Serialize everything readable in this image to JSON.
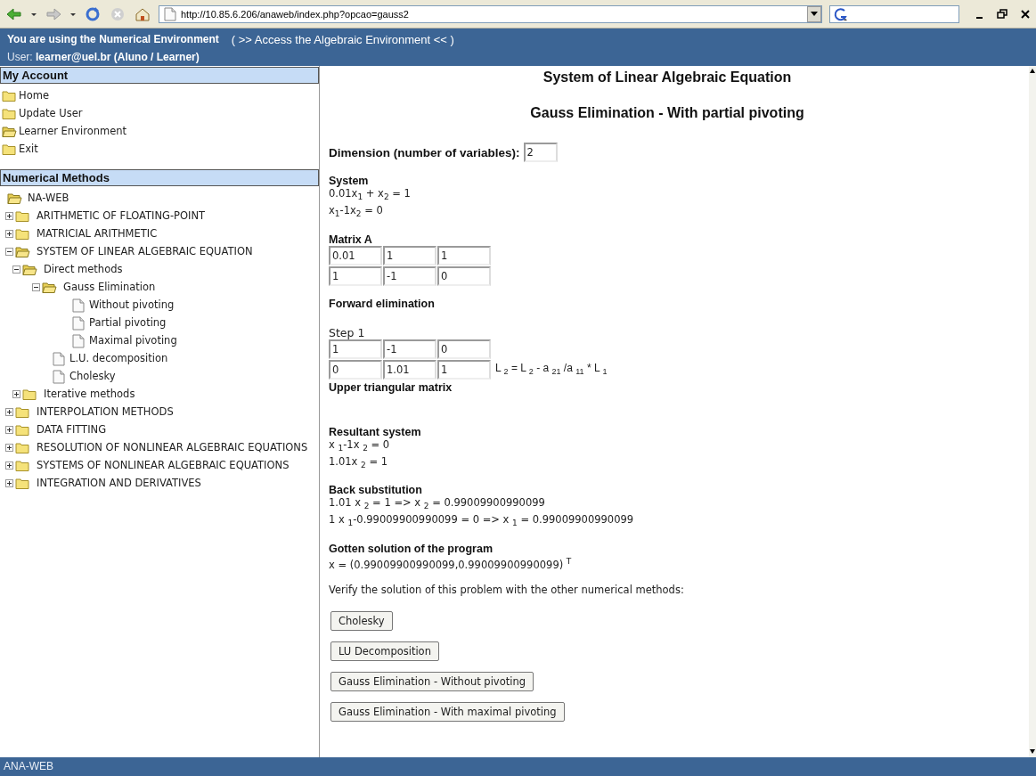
{
  "browser": {
    "address": "http://10.85.6.206/anaweb/index.php?opcao=gauss2"
  },
  "header": {
    "environment": "You are using the Numerical Environment",
    "switch_link": "( >> Access the Algebraic Environment << )",
    "user": "User: **learner@uel.br (Aluno / Learner)**"
  },
  "account": {
    "title": "My Account",
    "items": [
      {
        "label": "Home",
        "selected": false
      },
      {
        "label": "Update User",
        "selected": false
      },
      {
        "label": "Learner Environment",
        "selected": true
      },
      {
        "label": "Exit",
        "selected": false
      }
    ]
  },
  "methods": {
    "title": "Numerical Methods",
    "tree": {
      "label": "NA-WEB",
      "children": [
        {
          "label": "ARITHMETIC OF FLOATING-POINT",
          "kind": "folder",
          "expanded": false
        },
        {
          "label": "MATRICIAL ARITHMETIC",
          "kind": "folder",
          "expanded": false
        },
        {
          "label": "SYSTEM OF LINEAR ALGEBRAIC EQUATION",
          "kind": "folder",
          "expanded": true,
          "children": [
            {
              "label": "Direct methods",
              "kind": "folder",
              "expanded": true,
              "children": [
                {
                  "label": "Gauss Elimination",
                  "kind": "folder",
                  "expanded": true,
                  "children": [
                    {
                      "label": "Without pivoting",
                      "kind": "page"
                    },
                    {
                      "label": "Partial pivoting",
                      "kind": "page"
                    },
                    {
                      "label": "Maximal pivoting",
                      "kind": "page"
                    }
                  ]
                },
                {
                  "label": "L.U. decomposition",
                  "kind": "page"
                },
                {
                  "label": "Cholesky",
                  "kind": "page"
                }
              ]
            },
            {
              "label": "Iterative methods",
              "kind": "folder",
              "expanded": false
            }
          ]
        },
        {
          "label": "INTERPOLATION METHODS",
          "kind": "folder",
          "expanded": false
        },
        {
          "label": "DATA FITTING",
          "kind": "folder",
          "expanded": false
        },
        {
          "label": "RESOLUTION OF NONLINEAR ALGEBRAIC EQUATIONS",
          "kind": "folder",
          "expanded": false
        },
        {
          "label": "SYSTEMS OF NONLINEAR ALGEBRAIC EQUATIONS",
          "kind": "folder",
          "expanded": false
        },
        {
          "label": "INTEGRATION AND DERIVATIVES",
          "kind": "folder",
          "expanded": false
        }
      ]
    }
  },
  "main": {
    "title": "System of Linear Algebraic Equation",
    "subtitle": "Gauss Elimination - With partial pivoting",
    "dimension": {
      "label": "Dimension (number of variables):",
      "value": "2"
    },
    "sections": [
      {
        "kind": "text",
        "heading": "System",
        "lines": [
          "0.01x$_{1}$ + x$_{2}$ = 1",
          "x$_{1}$-1x$_{2}$ = 0"
        ]
      },
      {
        "kind": "matrix",
        "heading": "Matrix A",
        "rows": [
          [
            "0.01",
            "1",
            "1"
          ],
          [
            "1",
            "-1",
            "0"
          ]
        ]
      },
      {
        "kind": "text",
        "heading": "Forward elimination"
      },
      {
        "kind": "matrix",
        "label": "Step 1",
        "rows": [
          [
            "1",
            "-1",
            "0"
          ],
          [
            "0",
            "1.01",
            "1"
          ]
        ],
        "note": "L $_{2}$ = L $_{2}$ - a $_{21}$ /a $_{11}$ * L $_{1}$"
      },
      {
        "kind": "caption",
        "heading": "Upper triangular matrix"
      },
      {
        "kind": "text",
        "heading": "Resultant system",
        "lines": [
          "x $_{1}$-1x $_{2}$ = 0",
          "1.01x $_{2}$ = 1"
        ]
      },
      {
        "kind": "text",
        "heading": "Back substitution",
        "lines": [
          "1.01 x $_{2}$ = 1  =>  x $_{2}$ = 0.99009900990099",
          "1 x $_{1}$-0.99009900990099 = 0  =>  x $_{1}$ = 0.99009900990099"
        ]
      },
      {
        "kind": "text",
        "heading": "Gotten solution of the program",
        "lines": [
          "x = (0.99009900990099,0.99009900990099) $^{T}$"
        ]
      },
      {
        "kind": "paragraph",
        "text": "Verify the solution of this problem with the other numerical methods:"
      }
    ],
    "buttons": [
      "Cholesky",
      "LU Decomposition",
      "Gauss Elimination - Without pivoting",
      "Gauss Elimination - With maximal pivoting"
    ]
  },
  "status_bar": "ANA-WEB"
}
